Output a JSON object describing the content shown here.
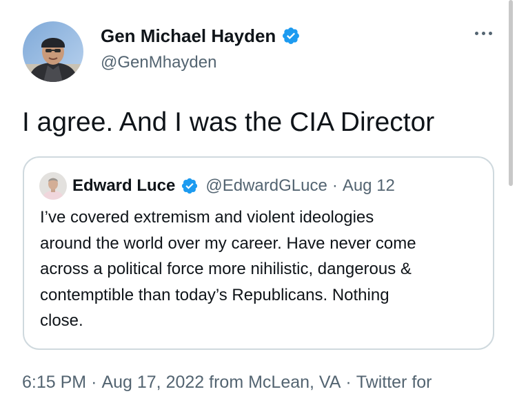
{
  "tweet": {
    "author": {
      "display_name": "Gen Michael Hayden",
      "handle": "@GenMhayden",
      "verified": true
    },
    "text": "I agree.  And I was the CIA Director",
    "quoted": {
      "author": {
        "display_name": "Edward Luce",
        "handle": "@EdwardGLuce",
        "verified": true
      },
      "separator": "·",
      "date": "Aug 12",
      "text_lines": [
        "I’ve covered extremism and violent ideologies",
        "around the world over my career. Have never come",
        "across a political force more nihilistic, dangerous &",
        "contemptible than today’s Republicans. Nothing",
        "close."
      ]
    },
    "time": "6:15 PM",
    "date": "Aug 17, 2022",
    "location": "from McLean, VA",
    "source": "Twitter for",
    "separator": "·"
  },
  "icons": {
    "verified_badge": "verified-badge-icon",
    "more": "more-options-icon"
  },
  "colors": {
    "verified_blue": "#1d9bf0",
    "text_primary": "#0f1419",
    "text_secondary": "#536471",
    "border": "#cfd9de"
  }
}
